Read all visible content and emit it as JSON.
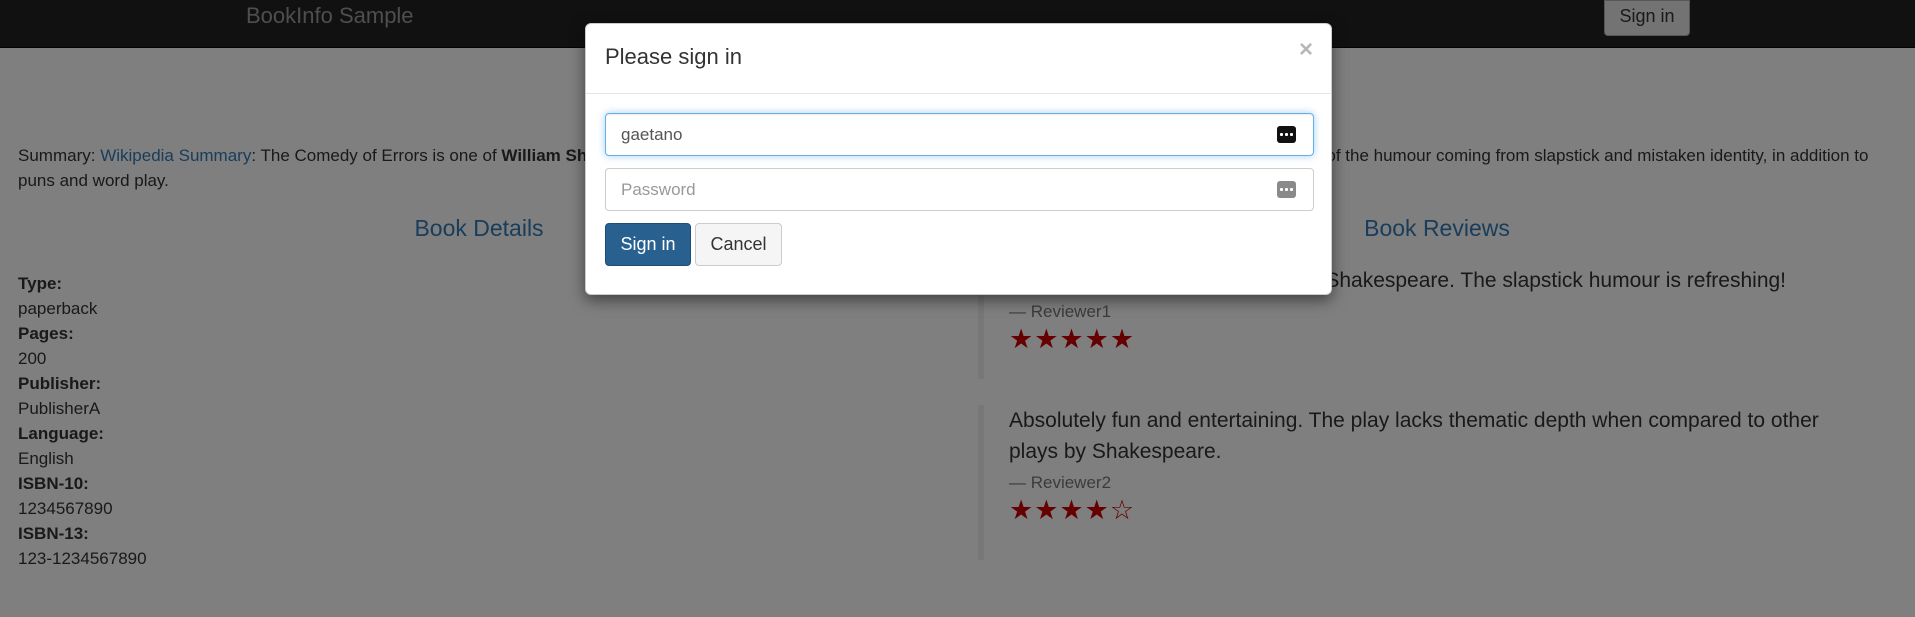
{
  "navbar": {
    "brand": "BookInfo Sample",
    "signin_label": "Sign in"
  },
  "summary": {
    "label": "Summary: ",
    "link_text": "Wikipedia Summary",
    "text_before_bold": ": The Comedy of Errors is one of ",
    "bold_text": "William Shakespeare's",
    "text_after_bold": " early plays. It is his shortest and one of his most farcical comedies, with a major part of the humour coming from slapstick and mistaken identity, in addition to puns and word play."
  },
  "book_details": {
    "title": "Book Details",
    "fields": [
      {
        "label": "Type:",
        "value": "paperback"
      },
      {
        "label": "Pages:",
        "value": "200"
      },
      {
        "label": "Publisher:",
        "value": "PublisherA"
      },
      {
        "label": "Language:",
        "value": "English"
      },
      {
        "label": "ISBN-10:",
        "value": "1234567890"
      },
      {
        "label": "ISBN-13:",
        "value": "123-1234567890"
      }
    ]
  },
  "book_reviews": {
    "title": "Book Reviews",
    "reviews": [
      {
        "text": "An extremely entertaining play by Shakespeare. The slapstick humour is refreshing!",
        "author": "— Reviewer1",
        "stars": "★★★★★",
        "rating": 5,
        "star_color": "#cc0000"
      },
      {
        "text": "Absolutely fun and entertaining. The play lacks thematic depth when compared to other plays by Shakespeare.",
        "author": "— Reviewer2",
        "stars": "★★★★☆",
        "rating": 4,
        "star_color": "#cc0000"
      }
    ]
  },
  "modal": {
    "title": "Please sign in",
    "close_glyph": "×",
    "username_value": "gaetano",
    "password_value": "",
    "password_placeholder": "Password",
    "signin_label": "Sign in",
    "cancel_label": "Cancel"
  },
  "colors": {
    "primary": "#286090",
    "link": "#337ab7",
    "navbar": "#222222"
  }
}
